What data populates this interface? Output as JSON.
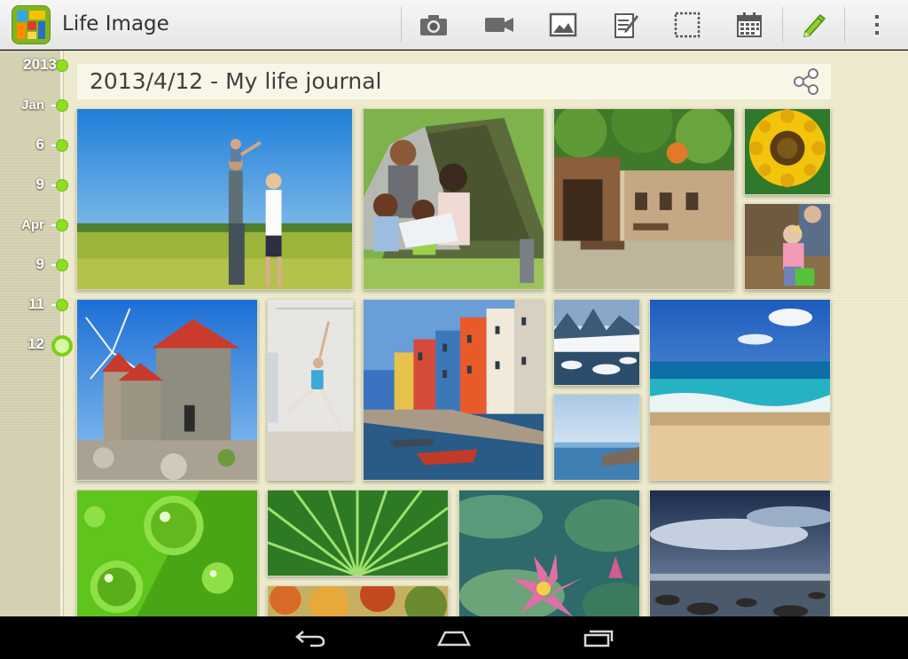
{
  "app": {
    "title": "Life Image",
    "icon": "life-image-app-icon"
  },
  "toolbar": {
    "buttons": [
      {
        "name": "camera-button",
        "icon": "camera-icon"
      },
      {
        "name": "video-button",
        "icon": "video-camera-icon"
      },
      {
        "name": "image-button",
        "icon": "picture-icon"
      },
      {
        "name": "note-button",
        "icon": "note-edit-icon"
      },
      {
        "name": "select-button",
        "icon": "dashed-frame-icon"
      },
      {
        "name": "calendar-button",
        "icon": "calendar-icon"
      },
      {
        "name": "edit-button",
        "icon": "pencil-icon"
      },
      {
        "name": "overflow-menu-button",
        "icon": "overflow-dots-icon"
      }
    ],
    "accent_color": "#7cc61e"
  },
  "timeline": {
    "items": [
      {
        "label": "2013"
      },
      {
        "label": "Jan"
      },
      {
        "label": "6"
      },
      {
        "label": "9"
      },
      {
        "label": "Apr"
      },
      {
        "label": "9"
      },
      {
        "label": "11"
      },
      {
        "label": "12",
        "selected": true
      }
    ]
  },
  "journal": {
    "title": "2013/4/12 - My life journal",
    "share_icon": "share-icon"
  },
  "photos": [
    {
      "subject": "family-in-meadow"
    },
    {
      "subject": "family-camping-tent"
    },
    {
      "subject": "courtyard-cafe"
    },
    {
      "subject": "sunflower"
    },
    {
      "subject": "child-gardening"
    },
    {
      "subject": "windmills"
    },
    {
      "subject": "ballet-dancer"
    },
    {
      "subject": "colorful-canal-houses"
    },
    {
      "subject": "snowy-forest"
    },
    {
      "subject": "seaside-pier"
    },
    {
      "subject": "beach-waves"
    },
    {
      "subject": "green-leaf-droplets"
    },
    {
      "subject": "palm-fronds"
    },
    {
      "subject": "autumn-foliage"
    },
    {
      "subject": "water-lily"
    },
    {
      "subject": "stormy-coast"
    }
  ],
  "nav": {
    "buttons": [
      {
        "name": "back-button",
        "icon": "back-arrow-icon"
      },
      {
        "name": "home-button",
        "icon": "home-icon"
      },
      {
        "name": "recents-button",
        "icon": "recent-apps-icon"
      }
    ]
  }
}
